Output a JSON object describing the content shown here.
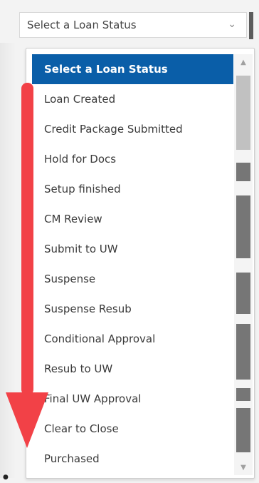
{
  "select": {
    "value": "Select a Loan Status"
  },
  "dropdown": {
    "options": [
      {
        "label": "Select a Loan Status",
        "selected": true
      },
      {
        "label": "Loan Created"
      },
      {
        "label": "Credit Package Submitted"
      },
      {
        "label": "Hold for Docs"
      },
      {
        "label": "Setup finished"
      },
      {
        "label": "CM Review"
      },
      {
        "label": "Submit to UW"
      },
      {
        "label": "Suspense"
      },
      {
        "label": "Suspense Resub"
      },
      {
        "label": "Conditional Approval"
      },
      {
        "label": "Resub to UW"
      },
      {
        "label": "Final UW Approval"
      },
      {
        "label": "Clear to Close"
      },
      {
        "label": "Purchased"
      }
    ]
  },
  "icons": {
    "select_chevron": "chevron-down-icon",
    "scroll_up": "triangle-up-icon",
    "scroll_down": "triangle-down-icon",
    "annotation_arrow": "arrow-down-icon"
  },
  "colors": {
    "selected_bg": "#0a5ea8",
    "arrow": "#f24147"
  }
}
